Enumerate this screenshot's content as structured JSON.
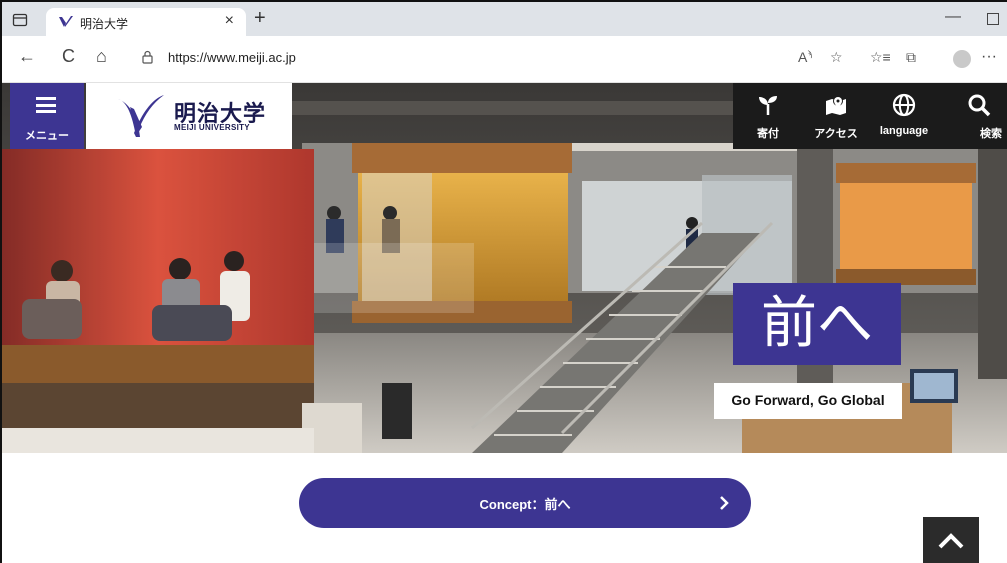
{
  "browser": {
    "tab_title": "明治大学",
    "tab_close": "×",
    "new_tab": "+",
    "url": "https://www.meiji.ac.jp",
    "nav": {
      "back": "←",
      "refresh": "C",
      "home": "⌂"
    },
    "win_minimize": "—",
    "more": "···",
    "toolbar_icons": [
      "read-aloud-icon",
      "favorite-star-icon",
      "favorites-list-icon",
      "collections-icon",
      "profile-icon",
      "more-icon"
    ]
  },
  "site": {
    "menu_label": "メニュー",
    "logo_jp": "明治大学",
    "logo_en": "MEIJI UNIVERSITY",
    "utility": [
      {
        "label": "寄付",
        "icon": "sprout-icon"
      },
      {
        "label": "アクセス",
        "icon": "map-pin-icon"
      },
      {
        "label": "language",
        "icon": "globe-icon"
      },
      {
        "label": "検索",
        "icon": "search-icon"
      }
    ],
    "hero": {
      "headline": "前へ",
      "slogan": "Go Forward, Go Global"
    },
    "concept_button": "Concept：前へ"
  },
  "colors": {
    "brand_purple": "#3d3592",
    "utility_bg": "#1b1b1b",
    "totop_bg": "#2b2b2b"
  }
}
